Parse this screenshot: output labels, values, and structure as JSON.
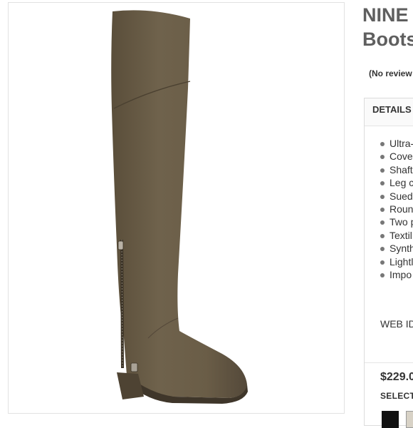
{
  "product": {
    "title": "NINE\nBoots",
    "reviews_label": "(No review"
  },
  "details": {
    "tab_label": "DETAILS",
    "bullets": [
      "Ultra-",
      "Cove",
      "Shaft",
      "Leg c",
      "Sued",
      "Roun",
      "Two p",
      "Textil",
      "Synth",
      "Lightl",
      "Impo"
    ],
    "web_id_label": "WEB ID"
  },
  "purchase": {
    "price": "$229.0",
    "select_label": "SELECT",
    "swatches": [
      "black",
      "taupe"
    ]
  },
  "image": {
    "alt": "olive suede over-the-knee boot",
    "boot_color": "#6b5e48"
  }
}
